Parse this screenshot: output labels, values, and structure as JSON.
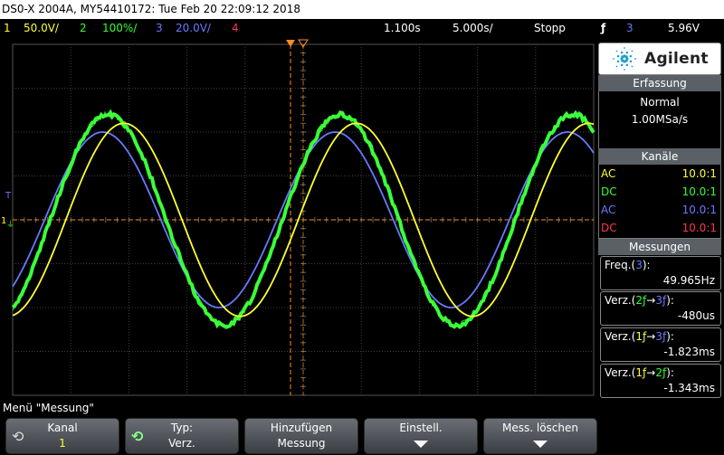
{
  "title": "DS0-X 2004A, MY54410172: Tue Feb 20 22:09:12 2018",
  "status": {
    "ch1_num": "1",
    "ch1_scale": "50.0V/",
    "ch2_num": "2",
    "ch2_scale": "100%/",
    "ch3_num": "3",
    "ch3_scale": "20.0V/",
    "ch4_num": "4",
    "delay": "1.100s",
    "timebase": "5.000s/",
    "run_state": "Stopp",
    "trigger_source": "3",
    "trigger_level": "5.96V"
  },
  "brand": "Agilent",
  "acquisition": {
    "header": "Erfassung",
    "mode": "Normal",
    "rate": "1.00MSa/s"
  },
  "channels": {
    "header": "Kanäle",
    "items": [
      {
        "coupling": "AC",
        "ratio": "10.0:1",
        "color": "#ffff33"
      },
      {
        "coupling": "DC",
        "ratio": "10.0:1",
        "color": "#33ff33"
      },
      {
        "coupling": "AC",
        "ratio": "10.0:1",
        "color": "#6a78ff"
      },
      {
        "coupling": "DC",
        "ratio": "10.0:1",
        "color": "#ff3355"
      }
    ]
  },
  "measurements": {
    "header": "Messungen",
    "items": [
      {
        "label_pre": "Freq.(",
        "src1": "3",
        "src1_color": "#6a78ff",
        "label_post": "):",
        "value": "49.965Hz"
      },
      {
        "label_pre": "Verz.(",
        "src1": "2",
        "src1_color": "#33ff33",
        "arrow": "→",
        "src2": "3",
        "src2_color": "#6a78ff",
        "label_post": "):",
        "value": "-480us"
      },
      {
        "label_pre": "Verz.(",
        "src1": "1",
        "src1_color": "#ffff33",
        "arrow": "→",
        "src2": "3",
        "src2_color": "#6a78ff",
        "label_post": "):",
        "value": "-1.823ms"
      },
      {
        "label_pre": "Verz.(",
        "src1": "1",
        "src1_color": "#ffff33",
        "arrow": "→",
        "src2": "2",
        "src2_color": "#33ff33",
        "label_post": "):",
        "value": "-1.343ms"
      }
    ]
  },
  "menu": {
    "title": "Menü \"Messung\"",
    "softkeys": [
      {
        "line1": "Kanal",
        "line2": "1"
      },
      {
        "line1": "Typ:",
        "line2": "Verz."
      },
      {
        "line1": "Hinzufügen",
        "line2": "Messung"
      },
      {
        "line1": "Einstell.",
        "line2": ""
      },
      {
        "line1": "Mess. löschen",
        "line2": ""
      }
    ]
  },
  "waveforms": {
    "ch1": {
      "color": "#ffff33",
      "amplitude_div": 2.2,
      "period_div": 4.0,
      "phase_ms": -1.823
    },
    "ch2": {
      "color": "#33ff33",
      "amplitude_div": 2.4,
      "period_div": 4.0,
      "phase_ms": -0.48
    },
    "ch3": {
      "color": "#6a78ff",
      "amplitude_div": 2.0,
      "period_div": 4.0,
      "phase_ms": 0
    }
  }
}
